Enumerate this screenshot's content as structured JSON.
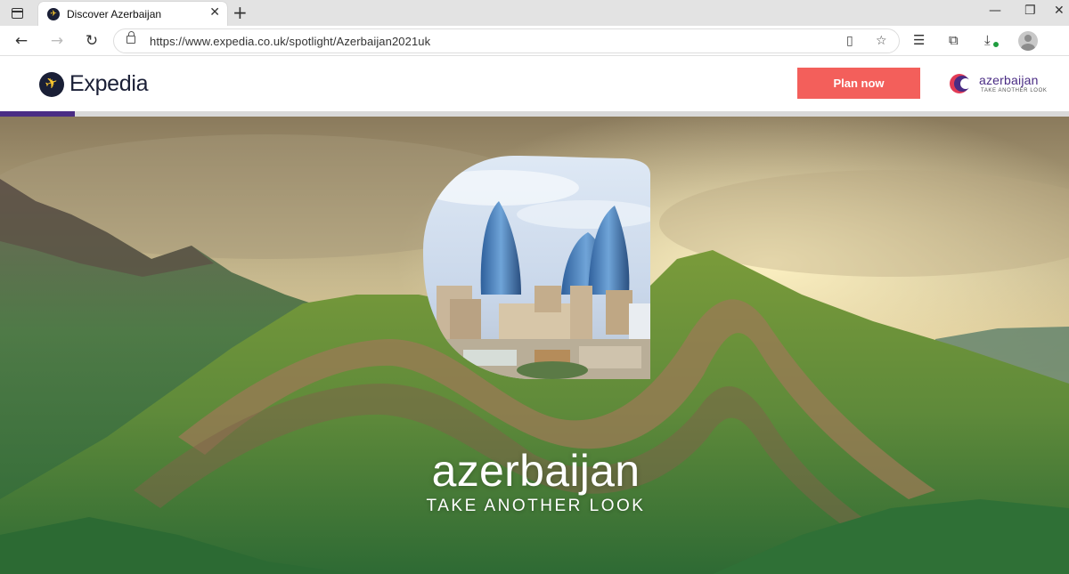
{
  "browser": {
    "tab_title": "Discover Azerbaijan",
    "tab_close": "✕",
    "new_tab": "+",
    "url": "https://www.expedia.co.uk/spotlight/Azerbaijan2021uk",
    "window_controls": {
      "minimize": "—",
      "restore": "❐",
      "close": "✕"
    },
    "nav": {
      "back": "←",
      "forward": "→",
      "refresh": "↻"
    },
    "icons": [
      "reader-view-icon",
      "add-favorite-icon",
      "favorites-icon",
      "collections-icon",
      "downloads-icon",
      "profile-icon"
    ]
  },
  "site": {
    "logo_text": "Expedia",
    "plan_button": "Plan now",
    "partner_name": "azerbaijan",
    "partner_tagline": "TAKE ANOTHER LOOK",
    "colors": {
      "plan_button": "#f35f5b",
      "brand_navy": "#1a1f36",
      "brand_yellow": "#fdc82e",
      "progress": "#4a2c84"
    },
    "progress_fraction": 0.07
  },
  "hero": {
    "title": "azerbaijan",
    "tagline": "TAKE ANOTHER LOOK"
  }
}
